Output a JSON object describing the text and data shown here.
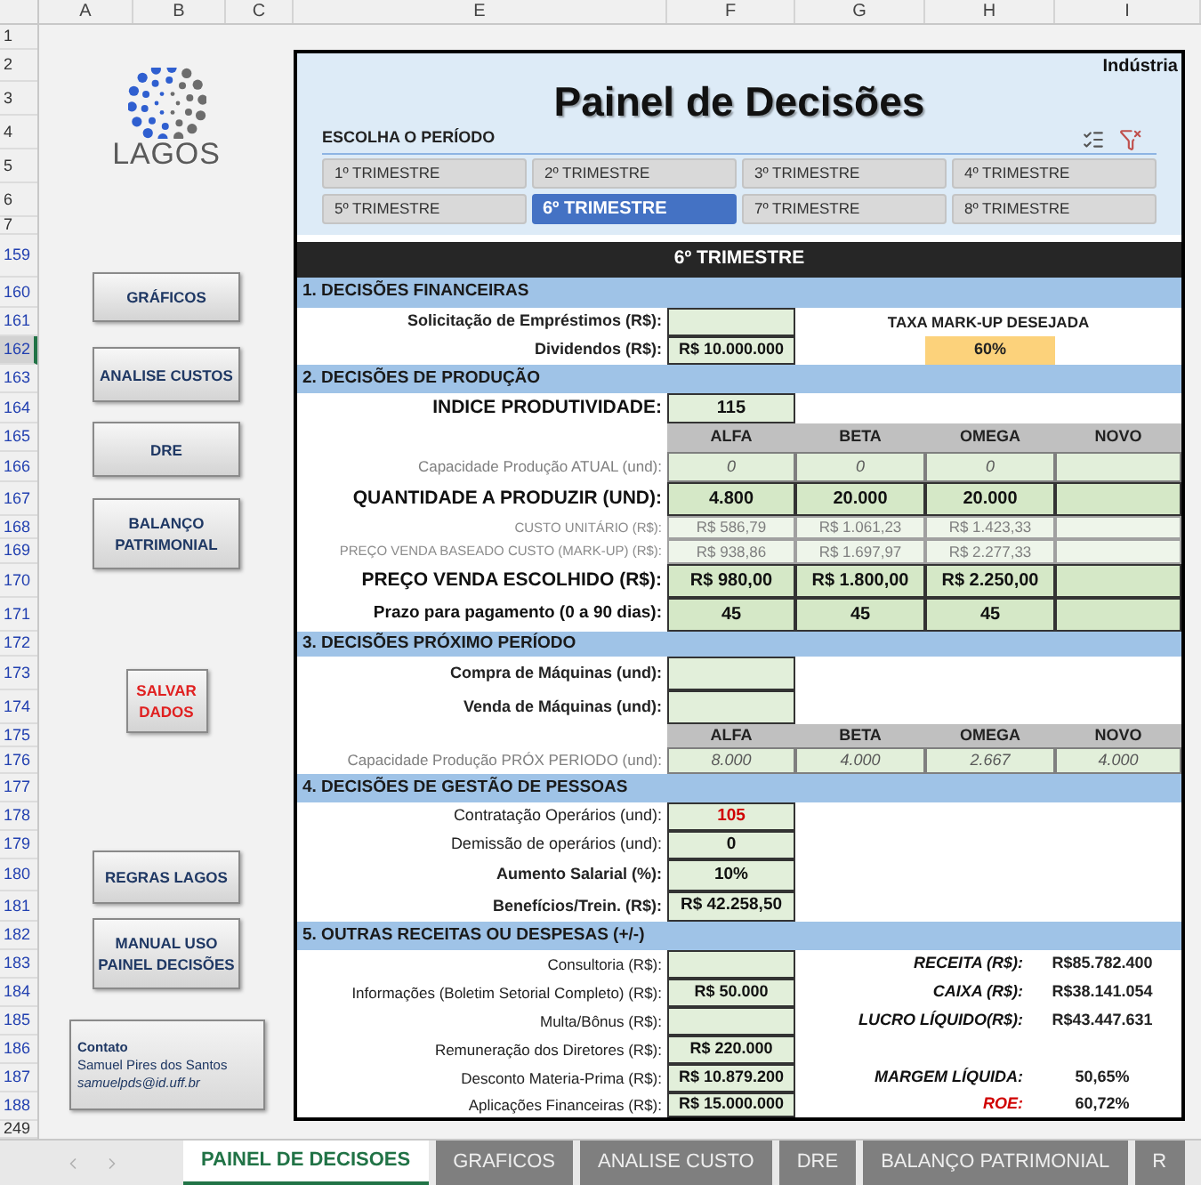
{
  "column_headers": [
    "A",
    "B",
    "C",
    "E",
    "F",
    "G",
    "H",
    "I"
  ],
  "row_headers": [
    {
      "label": "1",
      "selected": false,
      "filtered": false
    },
    {
      "label": "2",
      "selected": false,
      "filtered": false
    },
    {
      "label": "3",
      "selected": false,
      "filtered": false
    },
    {
      "label": "4",
      "selected": false,
      "filtered": false
    },
    {
      "label": "5",
      "selected": false,
      "filtered": false
    },
    {
      "label": "6",
      "selected": false,
      "filtered": false
    },
    {
      "label": "7",
      "selected": false,
      "filtered": false
    },
    {
      "label": "159",
      "selected": false,
      "filtered": true
    },
    {
      "label": "160",
      "selected": false,
      "filtered": true
    },
    {
      "label": "161",
      "selected": false,
      "filtered": true
    },
    {
      "label": "162",
      "selected": true,
      "filtered": true
    },
    {
      "label": "163",
      "selected": false,
      "filtered": true
    },
    {
      "label": "164",
      "selected": false,
      "filtered": true
    },
    {
      "label": "165",
      "selected": false,
      "filtered": true
    },
    {
      "label": "166",
      "selected": false,
      "filtered": true
    },
    {
      "label": "167",
      "selected": false,
      "filtered": true
    },
    {
      "label": "168",
      "selected": false,
      "filtered": true
    },
    {
      "label": "169",
      "selected": false,
      "filtered": true
    },
    {
      "label": "170",
      "selected": false,
      "filtered": true
    },
    {
      "label": "171",
      "selected": false,
      "filtered": true
    },
    {
      "label": "172",
      "selected": false,
      "filtered": true
    },
    {
      "label": "173",
      "selected": false,
      "filtered": true
    },
    {
      "label": "174",
      "selected": false,
      "filtered": true
    },
    {
      "label": "175",
      "selected": false,
      "filtered": true
    },
    {
      "label": "176",
      "selected": false,
      "filtered": true
    },
    {
      "label": "177",
      "selected": false,
      "filtered": true
    },
    {
      "label": "178",
      "selected": false,
      "filtered": true
    },
    {
      "label": "179",
      "selected": false,
      "filtered": true
    },
    {
      "label": "180",
      "selected": false,
      "filtered": true
    },
    {
      "label": "181",
      "selected": false,
      "filtered": true
    },
    {
      "label": "182",
      "selected": false,
      "filtered": true
    },
    {
      "label": "183",
      "selected": false,
      "filtered": true
    },
    {
      "label": "184",
      "selected": false,
      "filtered": true
    },
    {
      "label": "185",
      "selected": false,
      "filtered": true
    },
    {
      "label": "186",
      "selected": false,
      "filtered": true
    },
    {
      "label": "187",
      "selected": false,
      "filtered": true
    },
    {
      "label": "188",
      "selected": false,
      "filtered": true
    },
    {
      "label": "249",
      "selected": false,
      "filtered": false
    }
  ],
  "logo": {
    "name": "LAGOS"
  },
  "nav_buttons": [
    {
      "lines": [
        "GRÁFICOS"
      ]
    },
    {
      "lines": [
        "ANALISE CUSTOS"
      ]
    },
    {
      "lines": [
        "DRE"
      ]
    },
    {
      "lines": [
        "BALANÇO",
        "PATRIMONIAL"
      ]
    }
  ],
  "save_button": {
    "lines": [
      "SALVAR",
      "DADOS"
    ]
  },
  "help_buttons": [
    {
      "lines": [
        "REGRAS LAGOS"
      ]
    },
    {
      "lines": [
        "MANUAL USO",
        "PAINEL DECISÕES"
      ]
    }
  ],
  "contact": {
    "title": "Contato",
    "name": "Samuel Pires dos Santos",
    "email": "samuelpds@id.uff.br"
  },
  "panel": {
    "title": "Painel de Decisões",
    "industry": "Indústria",
    "period_prompt": "ESCOLHA O PERÍODO",
    "current_period": "6º TRIMESTRE",
    "periods": [
      {
        "label": "1º TRIMESTRE",
        "selected": false
      },
      {
        "label": "2º TRIMESTRE",
        "selected": false
      },
      {
        "label": "3º TRIMESTRE",
        "selected": false
      },
      {
        "label": "4º TRIMESTRE",
        "selected": false
      },
      {
        "label": "5º TRIMESTRE",
        "selected": false
      },
      {
        "label": "6º TRIMESTRE",
        "selected": true
      },
      {
        "label": "7º TRIMESTRE",
        "selected": false
      },
      {
        "label": "8º TRIMESTRE",
        "selected": false
      }
    ]
  },
  "financial": {
    "title": "1. DECISÕES FINANCEIRAS",
    "loan": {
      "label": "Solicitação de Empréstimos (R$):"
    },
    "dividends": {
      "label": "Dividendos (R$):",
      "value": "R$ 10.000.000"
    },
    "markup": {
      "label": "TAXA MARK-UP DESEJADA",
      "value": "60%"
    }
  },
  "production": {
    "title": "2. DECISÕES DE PRODUÇÃO",
    "productivity": {
      "label": "INDICE PRODUTIVIDADE:",
      "value": "115"
    },
    "products": [
      "ALFA",
      "BETA",
      "OMEGA",
      "NOVO"
    ],
    "rows": [
      {
        "kind": "capacity",
        "label": "Capacidade Produção ATUAL (und):",
        "values": [
          "0",
          "0",
          "0"
        ]
      },
      {
        "kind": "input",
        "label": "QUANTIDADE A PRODUZIR (UND):",
        "values": [
          "4.800",
          "20.000",
          "20.000"
        ]
      },
      {
        "kind": "computed",
        "label": "CUSTO UNITÁRIO (R$):",
        "values": [
          "R$ 586,79",
          "R$ 1.061,23",
          "R$ 1.423,33"
        ]
      },
      {
        "kind": "computed",
        "label": "PREÇO VENDA BASEADO CUSTO (MARK-UP) (R$):",
        "values": [
          "R$ 938,86",
          "R$ 1.697,97",
          "R$ 2.277,33"
        ]
      },
      {
        "kind": "input",
        "label": "PREÇO VENDA ESCOLHIDO (R$):",
        "values": [
          "R$ 980,00",
          "R$ 1.800,00",
          "R$ 2.250,00"
        ]
      },
      {
        "kind": "term",
        "label": "Prazo para pagamento (0 a 90 dias):",
        "values": [
          "45",
          "45",
          "45"
        ]
      }
    ]
  },
  "next_period": {
    "title": "3. DECISÕES PRÓXIMO PERÍODO",
    "machines": [
      {
        "label": "Compra de Máquinas (und):"
      },
      {
        "label": "Venda de Máquinas (und):"
      }
    ],
    "products": [
      "ALFA",
      "BETA",
      "OMEGA",
      "NOVO"
    ],
    "capacity": {
      "label": "Capacidade Produção PRÓX PERIODO (und):",
      "values": [
        "8.000",
        "4.000",
        "2.667",
        "4.000"
      ]
    }
  },
  "people": {
    "title": "4. DECISÕES DE GESTÃO DE PESSOAS",
    "rows": [
      {
        "label": "Contratação Operários (und):",
        "value": "105",
        "emphasis": false,
        "alert": true
      },
      {
        "label": "Demissão de operários (und):",
        "value": "0",
        "emphasis": false,
        "alert": false
      },
      {
        "label": "Aumento Salarial (%):",
        "value": "10%",
        "emphasis": true,
        "alert": false
      },
      {
        "label": "Benefícios/Trein. (R$):",
        "value": "R$ 42.258,50",
        "emphasis": true,
        "alert": false
      }
    ]
  },
  "other": {
    "title": "5. OUTRAS RECEITAS OU DESPESAS (+/-)",
    "rows": [
      {
        "label": "Consultoria (R$):",
        "result": {
          "label": "RECEITA (R$):",
          "value": "R$85.782.400",
          "alert": false
        }
      },
      {
        "label": "Informações (Boletim Setorial Completo) (R$):",
        "value": "R$ 50.000",
        "result": {
          "label": "CAIXA (R$):",
          "value": "R$38.141.054",
          "alert": false
        }
      },
      {
        "label": "Multa/Bônus (R$):",
        "result": {
          "label": "LUCRO LÍQUIDO(R$):",
          "value": "R$43.447.631",
          "alert": false
        }
      },
      {
        "label": "Remuneração dos Diretores (R$):",
        "value": "R$ 220.000"
      },
      {
        "label": "Desconto Materia-Prima (R$):",
        "value": "R$ 10.879.200",
        "result": {
          "label": "MARGEM LÍQUIDA:",
          "value": "50,65%",
          "alert": false
        }
      },
      {
        "label": "Aplicações Financeiras (R$):",
        "value": "R$ 15.000.000",
        "result": {
          "label": "ROE:",
          "value": "60,72%",
          "alert": true
        }
      }
    ]
  },
  "sheet_tabs": [
    {
      "label": "PAINEL DE DECISOES",
      "selected": true
    },
    {
      "label": "GRAFICOS",
      "selected": false
    },
    {
      "label": "ANALISE CUSTO",
      "selected": false
    },
    {
      "label": "DRE",
      "selected": false
    },
    {
      "label": "BALANÇO PATRIMONIAL",
      "selected": false
    },
    {
      "label": "R",
      "selected": false
    }
  ]
}
